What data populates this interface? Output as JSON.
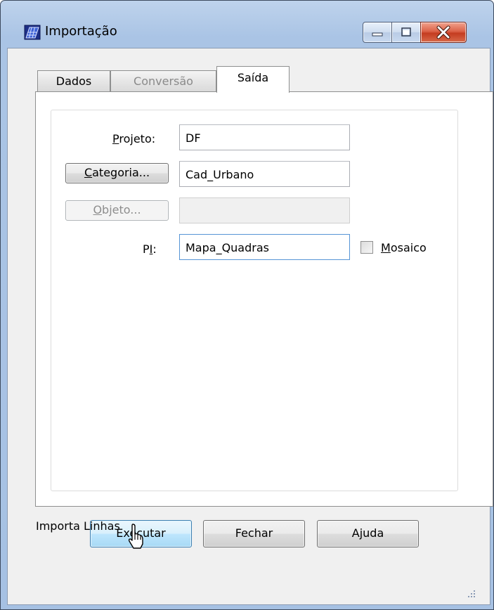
{
  "window": {
    "title": "Importação",
    "icon": "grid-map-icon",
    "controls": [
      "minimize-icon",
      "maximize-icon",
      "close-icon"
    ]
  },
  "tabs": [
    {
      "label": "Dados",
      "state": "normal"
    },
    {
      "label": "Conversão",
      "state": "disabled"
    },
    {
      "label": "Saída",
      "state": "selected"
    }
  ],
  "form": {
    "projeto": {
      "label_key": "P",
      "label_rest": "rojeto:",
      "value": "DF"
    },
    "categoria": {
      "button_key": "C",
      "button_rest": "ategoria...",
      "value": "Cad_Urbano"
    },
    "objeto": {
      "button_key": "O",
      "button_rest": "bjeto...",
      "value": ""
    },
    "pi": {
      "label_pre": "P",
      "label_key": "I",
      "label_post": ":",
      "value": "Mapa_Quadras"
    },
    "mosaico": {
      "label_key": "M",
      "label_rest": "osaico",
      "checked": false
    }
  },
  "buttons": {
    "executar": "Executar",
    "fechar": "Fechar",
    "ajuda": "Ajuda"
  },
  "status": "Importa Linhas"
}
